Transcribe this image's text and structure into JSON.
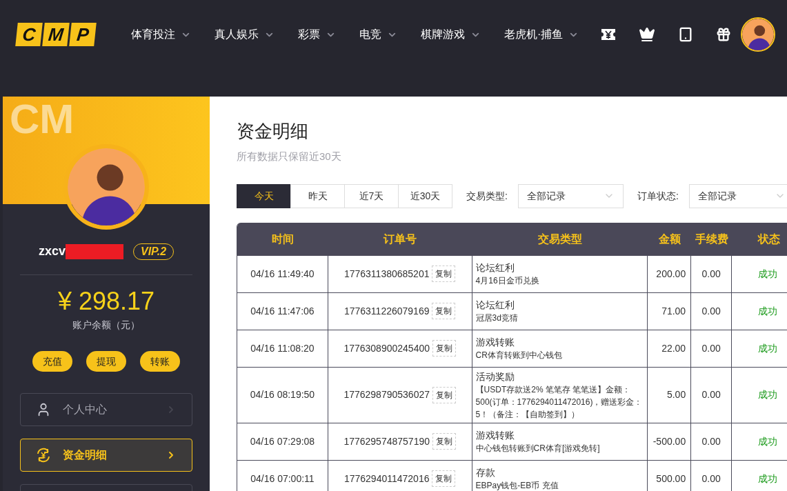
{
  "header": {
    "logo": [
      "C",
      "M",
      "P"
    ],
    "nav": [
      {
        "label": "体育投注"
      },
      {
        "label": "真人娱乐"
      },
      {
        "label": "彩票"
      },
      {
        "label": "电竞"
      },
      {
        "label": "棋牌游戏"
      },
      {
        "label": "老虎机·捕鱼"
      }
    ]
  },
  "sidebar": {
    "banner_mark": "CM",
    "username": "zxcv",
    "vip": "VIP.2",
    "balance": "¥ 298.17",
    "balance_label": "账户余额（元）",
    "actions": [
      "充值",
      "提现",
      "转账"
    ],
    "menu": [
      {
        "label": "个人中心",
        "kind": "user",
        "selected": false
      },
      {
        "label": "资金明细",
        "kind": "money",
        "selected": true
      }
    ]
  },
  "main": {
    "title": "资金明细",
    "subtitle": "所有数据只保留近30天",
    "ranges": [
      {
        "label": "今天",
        "selected": true
      },
      {
        "label": "昨天",
        "selected": false
      },
      {
        "label": "近7天",
        "selected": false
      },
      {
        "label": "近30天",
        "selected": false
      }
    ],
    "filters": [
      {
        "label": "交易类型:",
        "value": "全部记录"
      },
      {
        "label": "订单状态:",
        "value": "全部记录"
      }
    ],
    "table": {
      "columns": [
        "时间",
        "订单号",
        "交易类型",
        "金额",
        "手续费",
        "状态"
      ],
      "rows": [
        {
          "time": "04/16 11:49:40",
          "order": "1776311380685201",
          "type": "论坛红利",
          "copy": "复制",
          "detail": "4月16日金币兑换",
          "amount": "200.00",
          "fee": "0.00",
          "status": "成功"
        },
        {
          "time": "04/16 11:47:06",
          "order": "1776311226079169",
          "type": "论坛红利",
          "copy": "复制",
          "detail": "冠居3d竞猜",
          "amount": "71.00",
          "fee": "0.00",
          "status": "成功"
        },
        {
          "time": "04/16 11:08:20",
          "order": "1776308900245400",
          "type": "游戏转账",
          "copy": "复制",
          "detail": "CR体育转账到中心钱包",
          "amount": "22.00",
          "fee": "0.00",
          "status": "成功"
        },
        {
          "time": "04/16 08:19:50",
          "order": "1776298790536027",
          "type": "活动奖励",
          "copy": "复制",
          "detail": "【USDT存款送2% 笔笔存 笔笔送】金额：500(订单：1776294011472016)，赠送彩金：5！（备注：【自助签到】）",
          "amount": "5.00",
          "fee": "0.00",
          "status": "成功"
        },
        {
          "time": "04/16 07:29:08",
          "order": "1776295748757190",
          "type": "游戏转账",
          "copy": "复制",
          "detail": "中心钱包转账到CR体育[游戏免转]",
          "amount": "-500.00",
          "fee": "0.00",
          "status": "成功"
        },
        {
          "time": "04/16 07:00:11",
          "order": "1776294011472016",
          "type": "存款",
          "copy": "复制",
          "detail": "EBPay钱包-EB币 充值",
          "amount": "500.00",
          "fee": "0.00",
          "status": "成功"
        }
      ]
    }
  }
}
